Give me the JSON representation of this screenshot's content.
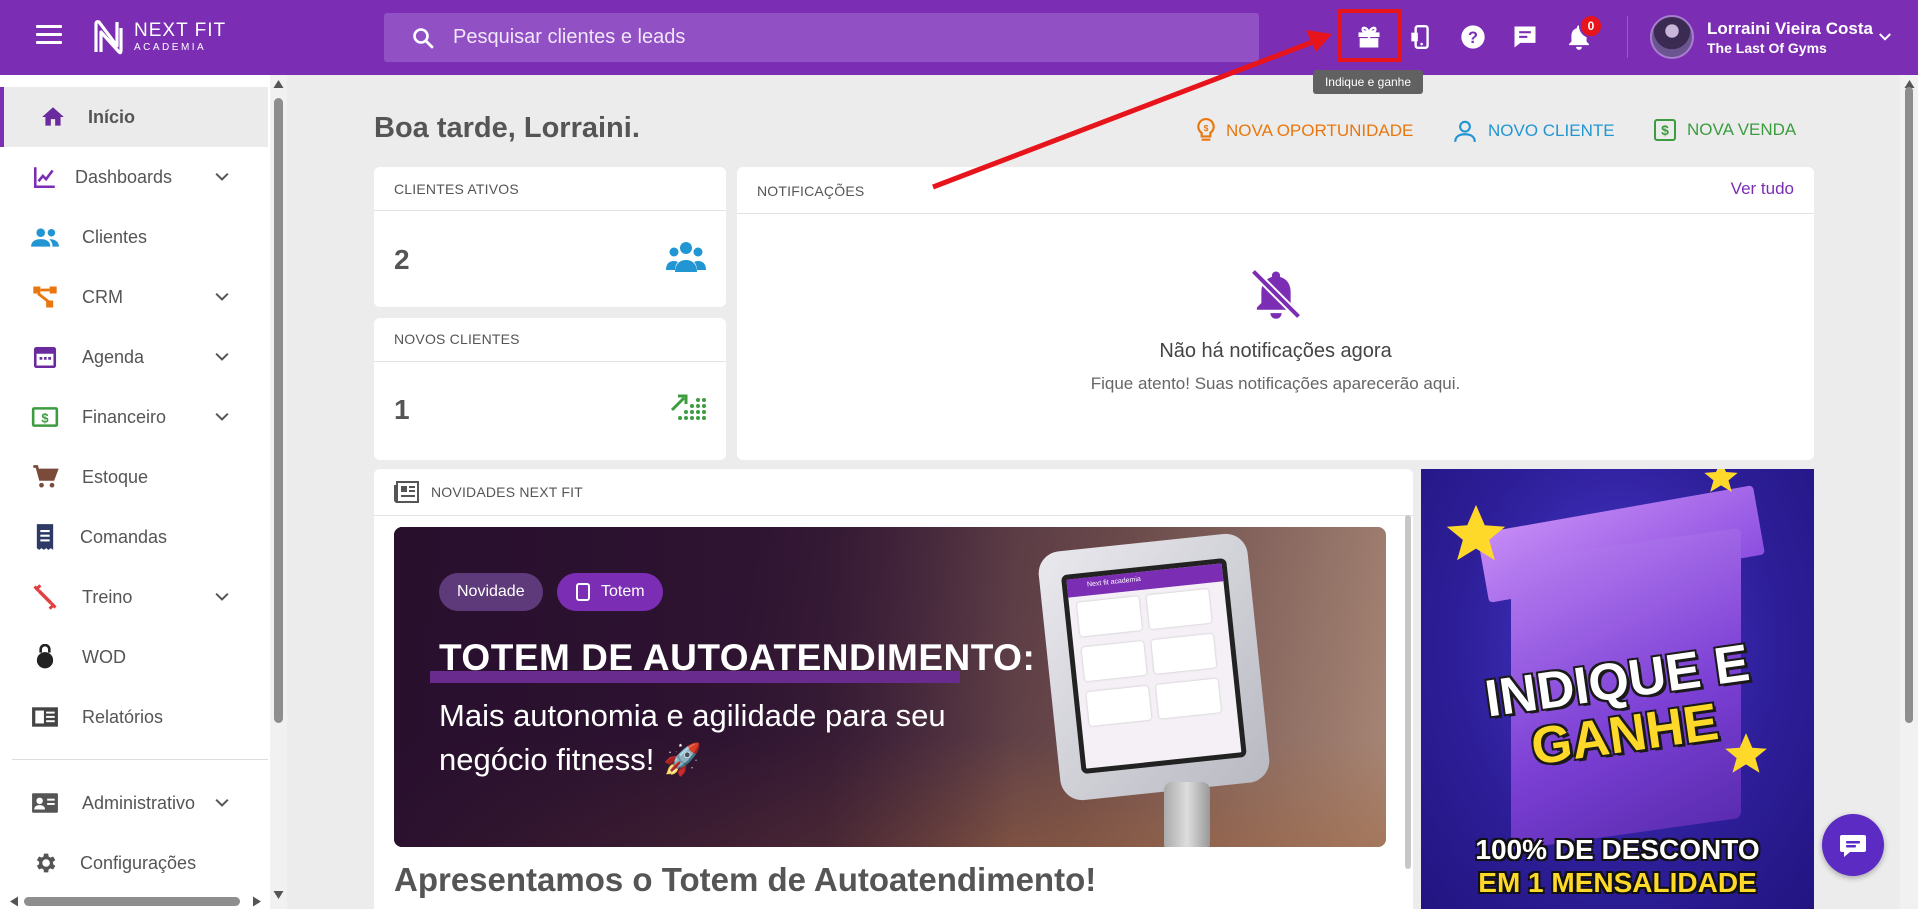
{
  "app": {
    "logo_line1": "NEXT FIT",
    "logo_line2": "ACADEMIA",
    "search_placeholder": "Pesquisar clientes e leads",
    "notification_count": "0",
    "tooltip": "Indique e ganhe",
    "user_name": "Lorraini Vieira Costa",
    "user_gym": "The Last Of Gyms"
  },
  "sidebar": {
    "items": [
      {
        "label": "Início",
        "icon": "home-icon"
      },
      {
        "label": "Dashboards",
        "icon": "chart-line-icon"
      },
      {
        "label": "Clientes",
        "icon": "people-icon"
      },
      {
        "label": "CRM",
        "icon": "crm-icon"
      },
      {
        "label": "Agenda",
        "icon": "calendar-icon"
      },
      {
        "label": "Financeiro",
        "icon": "money-icon"
      },
      {
        "label": "Estoque",
        "icon": "cart-icon"
      },
      {
        "label": "Comandas",
        "icon": "receipt-icon"
      },
      {
        "label": "Treino",
        "icon": "dumbbell-icon"
      },
      {
        "label": "WOD",
        "icon": "kettlebell-icon"
      },
      {
        "label": "Relatórios",
        "icon": "report-icon"
      },
      {
        "label": "Administrativo",
        "icon": "id-card-icon"
      },
      {
        "label": "Configurações",
        "icon": "gear-icon"
      }
    ]
  },
  "main": {
    "greeting": "Boa tarde, Lorraini.",
    "actions": {
      "nova_oportunidade": "NOVA OPORTUNIDADE",
      "novo_cliente": "NOVO CLIENTE",
      "nova_venda": "NOVA VENDA"
    },
    "clientes_ativos": {
      "label": "CLIENTES ATIVOS",
      "value": "2"
    },
    "novos_clientes": {
      "label": "NOVOS CLIENTES",
      "value": "1"
    },
    "notificacoes": {
      "label": "NOTIFICAÇÕES",
      "link": "Ver tudo",
      "empty_title": "Não há notificações agora",
      "empty_sub": "Fique atento! Suas notificações aparecerão aqui."
    },
    "novidades": {
      "label": "NOVIDADES NEXT FIT",
      "chip1": "Novidade",
      "chip2": "Totem",
      "banner_title": "TOTEM DE AUTOATENDIMENTO:",
      "banner_sub": "Mais autonomia e agilidade para seu negócio fitness! 🚀",
      "tablet_header": "Next fit academia",
      "article_title": "Apresentamos o Totem de Autoatendimento!"
    },
    "promo": {
      "title1": "INDIQUE E",
      "title2": "GANHE",
      "bottom1": "100% DE DESCONTO",
      "bottom2": "EM 1 MENSALIDADE"
    }
  },
  "colors": {
    "brand": "#7b2db3",
    "orange": "#e8770f",
    "blue": "#2196d3",
    "green": "#3c9c3f",
    "highlight": "#e8141b"
  }
}
